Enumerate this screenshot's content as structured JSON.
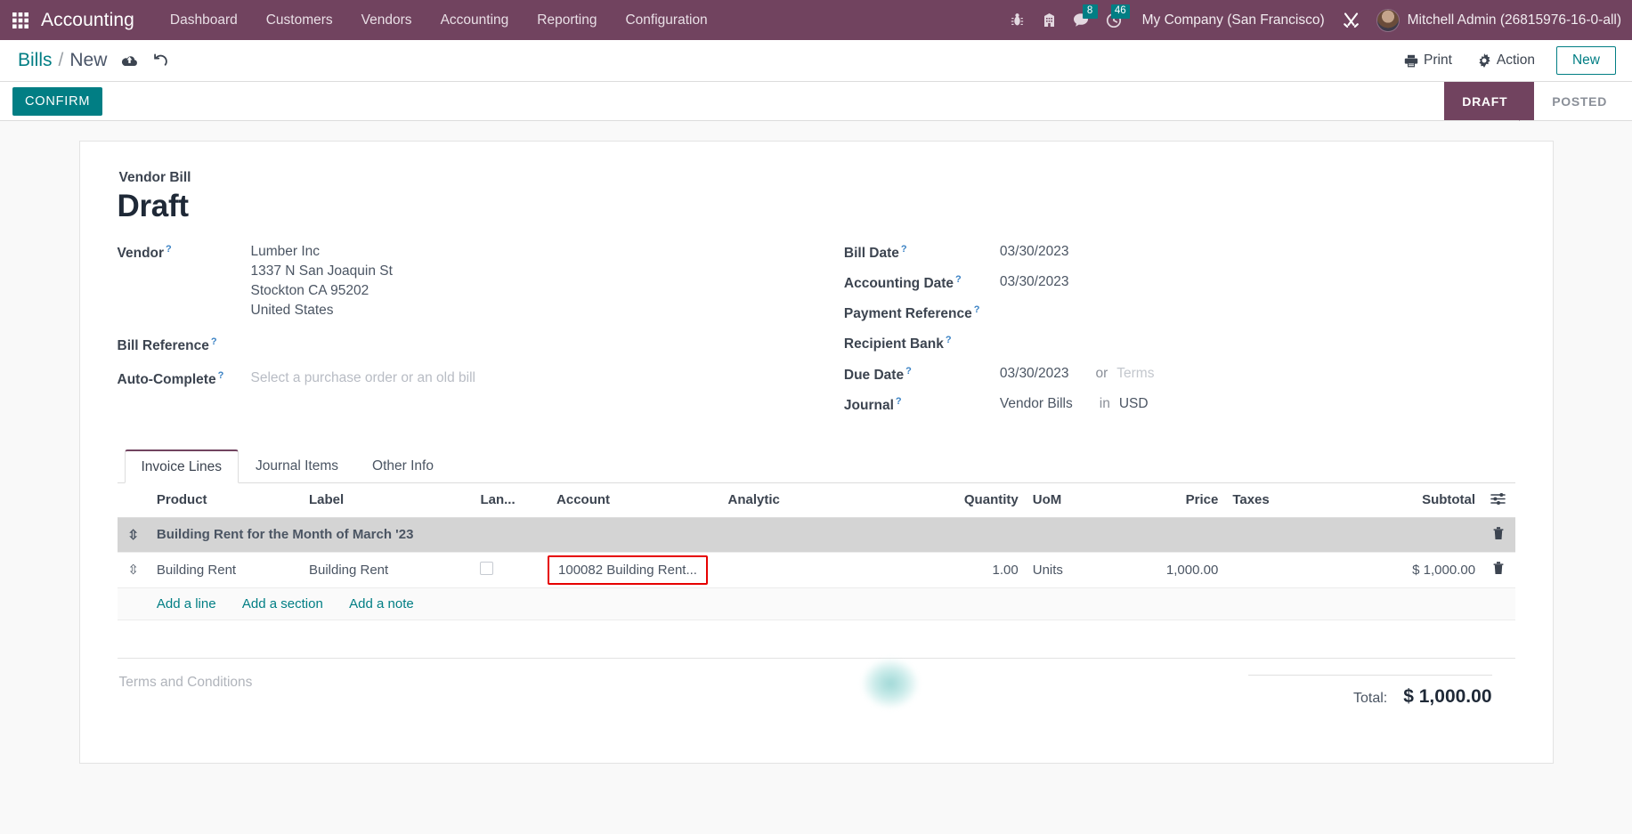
{
  "navbar": {
    "apps_icon": "apps-grid-icon",
    "brand": "Accounting",
    "menu": [
      {
        "label": "Dashboard"
      },
      {
        "label": "Customers"
      },
      {
        "label": "Vendors"
      },
      {
        "label": "Accounting"
      },
      {
        "label": "Reporting"
      },
      {
        "label": "Configuration"
      }
    ],
    "sys_icons": [
      {
        "name": "bug-icon"
      },
      {
        "name": "building-icon"
      },
      {
        "name": "chat-icon",
        "badge": "8"
      },
      {
        "name": "activity-clock-icon",
        "badge": "46"
      }
    ],
    "company": "My Company (San Francisco)",
    "tools_icon": "wrench-tools-icon",
    "user": "Mitchell Admin (26815976-16-0-all)",
    "accent_purple": "#71435f",
    "accent_teal": "#017e84"
  },
  "control_panel": {
    "breadcrumb_root": "Bills",
    "breadcrumb_sep": "/",
    "breadcrumb_current": "New",
    "save_icon": "cloud-upload-icon",
    "discard_icon": "undo-icon",
    "print_label": "Print",
    "action_label": "Action",
    "new_label": "New"
  },
  "statusbar": {
    "confirm_label": "CONFIRM",
    "steps": [
      {
        "label": "DRAFT",
        "active": true
      },
      {
        "label": "POSTED",
        "active": false
      }
    ]
  },
  "form": {
    "doc_type": "Vendor Bill",
    "doc_state": "Draft",
    "left": {
      "vendor_label": "Vendor",
      "vendor_name": "Lumber Inc",
      "vendor_address": [
        "1337 N San Joaquin St",
        "Stockton CA 95202",
        "United States"
      ],
      "bill_reference_label": "Bill Reference",
      "bill_reference_value": "",
      "auto_complete_label": "Auto-Complete",
      "auto_complete_placeholder": "Select a purchase order or an old bill"
    },
    "right": {
      "bill_date_label": "Bill Date",
      "bill_date_value": "03/30/2023",
      "accounting_date_label": "Accounting Date",
      "accounting_date_value": "03/30/2023",
      "payment_reference_label": "Payment Reference",
      "payment_reference_value": "",
      "recipient_bank_label": "Recipient Bank",
      "recipient_bank_value": "",
      "due_date_label": "Due Date",
      "due_date_value": "03/30/2023",
      "due_date_or": "or",
      "terms_placeholder": "Terms",
      "journal_label": "Journal",
      "journal_value": "Vendor Bills",
      "journal_in": "in",
      "currency": "USD"
    }
  },
  "notebook": {
    "tabs": [
      {
        "label": "Invoice Lines",
        "active": true
      },
      {
        "label": "Journal Items",
        "active": false
      },
      {
        "label": "Other Info",
        "active": false
      }
    ]
  },
  "lines_table": {
    "columns": [
      {
        "label": "Product",
        "align": "left"
      },
      {
        "label": "Label",
        "align": "left"
      },
      {
        "label": "Lan...",
        "align": "left"
      },
      {
        "label": "Account",
        "align": "left"
      },
      {
        "label": "Analytic",
        "align": "left"
      },
      {
        "label": "Quantity",
        "align": "right"
      },
      {
        "label": "UoM",
        "align": "left"
      },
      {
        "label": "Price",
        "align": "right"
      },
      {
        "label": "Taxes",
        "align": "left"
      },
      {
        "label": "Subtotal",
        "align": "right"
      }
    ],
    "optional_columns_icon": "sliders-settings-icon",
    "section": {
      "title": "Building Rent for the Month  of March '23",
      "drag_icon": "drag-handle-icon",
      "delete_icon": "trash-icon"
    },
    "rows": [
      {
        "drag_icon": "drag-handle-icon",
        "product": "Building Rent",
        "label": "Building Rent",
        "landed_cost_checked": false,
        "account": "100082 Building Rent...",
        "account_highlighted": true,
        "analytic": "",
        "quantity": "1.00",
        "uom": "Units",
        "price": "1,000.00",
        "taxes": "",
        "subtotal": "$ 1,000.00",
        "delete_icon": "trash-icon"
      }
    ],
    "add_links": [
      {
        "label": "Add a line"
      },
      {
        "label": "Add a section"
      },
      {
        "label": "Add a note"
      }
    ],
    "highlight_color": "#e60000"
  },
  "footer": {
    "terms_label": "Terms and Conditions",
    "total_label": "Total:",
    "total_value": "$ 1,000.00"
  }
}
